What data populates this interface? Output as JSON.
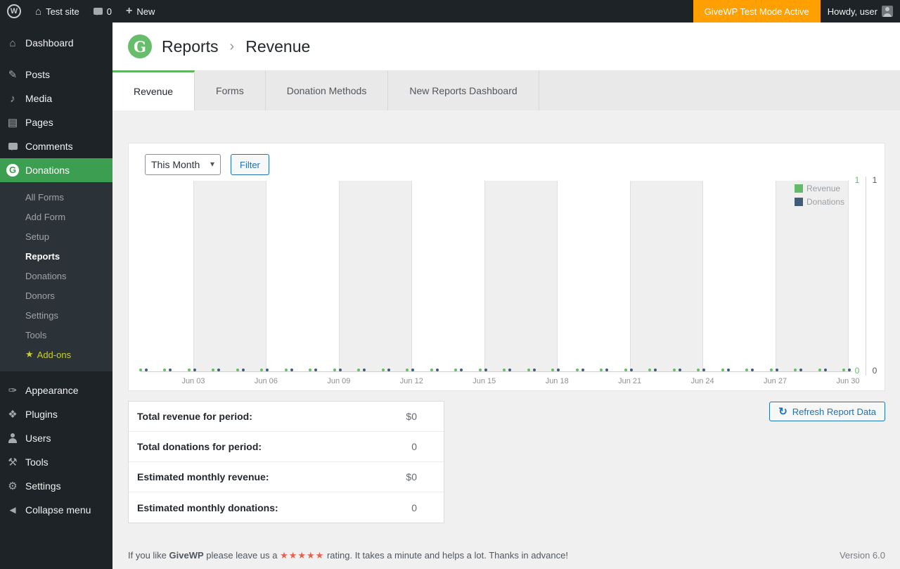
{
  "admin_bar": {
    "site_name": "Test site",
    "comment_count": "0",
    "new_label": "New",
    "test_mode_label": "GiveWP Test Mode Active",
    "howdy_label": "Howdy, user"
  },
  "sidebar": {
    "items": [
      {
        "label": "Dashboard"
      },
      {
        "label": "Posts"
      },
      {
        "label": "Media"
      },
      {
        "label": "Pages"
      },
      {
        "label": "Comments"
      },
      {
        "label": "Donations"
      },
      {
        "label": "Appearance"
      },
      {
        "label": "Plugins"
      },
      {
        "label": "Users"
      },
      {
        "label": "Tools"
      },
      {
        "label": "Settings"
      },
      {
        "label": "Collapse menu"
      }
    ],
    "submenu": [
      "All Forms",
      "Add Form",
      "Setup",
      "Reports",
      "Donations",
      "Donors",
      "Settings",
      "Tools",
      "Add-ons"
    ]
  },
  "header": {
    "title": "Reports",
    "separator": "›",
    "subtitle": "Revenue"
  },
  "tabs": {
    "items": [
      "Revenue",
      "Forms",
      "Donation Methods",
      "New Reports Dashboard"
    ]
  },
  "filters": {
    "period": "This Month",
    "filter_label": "Filter"
  },
  "chart_data": {
    "type": "line",
    "title": "",
    "x": [
      "Jun 01",
      "Jun 02",
      "Jun 03",
      "Jun 04",
      "Jun 05",
      "Jun 06",
      "Jun 07",
      "Jun 08",
      "Jun 09",
      "Jun 10",
      "Jun 11",
      "Jun 12",
      "Jun 13",
      "Jun 14",
      "Jun 15",
      "Jun 16",
      "Jun 17",
      "Jun 18",
      "Jun 19",
      "Jun 20",
      "Jun 21",
      "Jun 22",
      "Jun 23",
      "Jun 24",
      "Jun 25",
      "Jun 26",
      "Jun 27",
      "Jun 28",
      "Jun 29",
      "Jun 30"
    ],
    "tick_labels": [
      "Jun 03",
      "Jun 06",
      "Jun 09",
      "Jun 12",
      "Jun 15",
      "Jun 18",
      "Jun 21",
      "Jun 24",
      "Jun 27",
      "Jun 30"
    ],
    "series": [
      {
        "name": "Revenue",
        "color": "#66bb6a",
        "axis_min": 0,
        "axis_max": 1,
        "values": [
          0,
          0,
          0,
          0,
          0,
          0,
          0,
          0,
          0,
          0,
          0,
          0,
          0,
          0,
          0,
          0,
          0,
          0,
          0,
          0,
          0,
          0,
          0,
          0,
          0,
          0,
          0,
          0,
          0,
          0
        ]
      },
      {
        "name": "Donations",
        "color": "#415c77",
        "axis_min": 0,
        "axis_max": 1,
        "values": [
          0,
          0,
          0,
          0,
          0,
          0,
          0,
          0,
          0,
          0,
          0,
          0,
          0,
          0,
          0,
          0,
          0,
          0,
          0,
          0,
          0,
          0,
          0,
          0,
          0,
          0,
          0,
          0,
          0,
          0
        ]
      }
    ],
    "legend_position": "top-right",
    "grid": "vertical-bands"
  },
  "summary": {
    "rows": [
      {
        "label": "Total revenue for period:",
        "value": "$0"
      },
      {
        "label": "Total donations for period:",
        "value": "0"
      },
      {
        "label": "Estimated monthly revenue:",
        "value": "$0"
      },
      {
        "label": "Estimated monthly donations:",
        "value": "0"
      }
    ]
  },
  "actions": {
    "refresh_label": "Refresh Report Data"
  },
  "footer": {
    "prefix": "If you like ",
    "brand": "GiveWP",
    "middle": " please leave us a ",
    "stars": "★★★★★",
    "suffix": " rating. It takes a minute and helps a lot. Thanks in advance!",
    "version": "Version 6.0"
  }
}
